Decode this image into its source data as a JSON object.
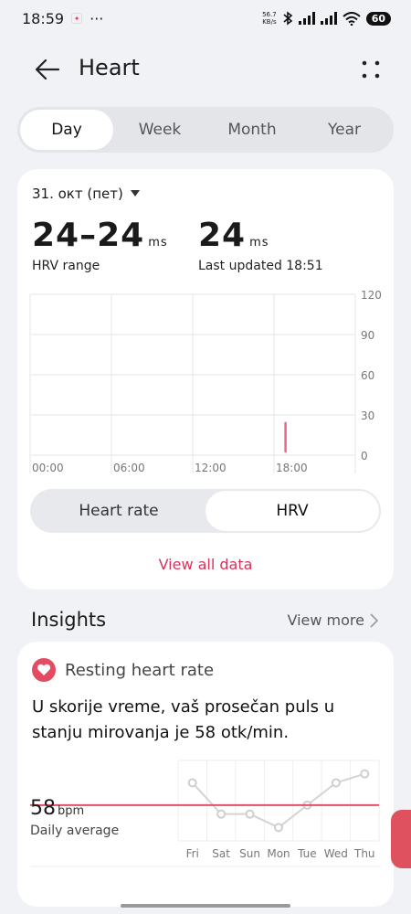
{
  "status_bar": {
    "time": "18:59",
    "dots": "···",
    "net_speed_top": "56.7",
    "net_speed_bottom": "KB/s",
    "battery": "60"
  },
  "header": {
    "title": "Heart"
  },
  "period_tabs": [
    "Day",
    "Week",
    "Month",
    "Year"
  ],
  "summary": {
    "date": "31. окт (пет)",
    "hrv_range_value": "24–24",
    "hrv_range_unit": "ms",
    "hrv_range_label": "HRV range",
    "latest_value": "24",
    "latest_unit": "ms",
    "latest_label": "Last updated 18:51"
  },
  "chart_data": [
    {
      "type": "bar",
      "x_ticks": [
        "00:00",
        "06:00",
        "12:00",
        "18:00"
      ],
      "y_ticks": [
        "120",
        "90",
        "60",
        "30",
        "0"
      ],
      "ylim": [
        0,
        120
      ],
      "series": [
        {
          "x": [
            "18:51"
          ],
          "values": [
            24
          ]
        }
      ],
      "grid": true
    },
    {
      "type": "line",
      "categories": [
        "Fri",
        "Sat",
        "Sun",
        "Mon",
        "Tue",
        "Wed",
        "Thu"
      ],
      "values": [
        63,
        56,
        56,
        53,
        58,
        63,
        65
      ],
      "reference_line": 58,
      "ylim": [
        50,
        68
      ]
    }
  ],
  "metric_toggle": {
    "options": [
      "Heart rate",
      "HRV"
    ],
    "selected": "HRV"
  },
  "view_all_label": "View all data",
  "insights": {
    "title": "Insights",
    "view_more_label": "View more",
    "card_title": "Resting heart rate",
    "text": "U skorije vreme, vaš prosečan puls u stanju mirovanja je 58 otk/min.",
    "avg_value": "58",
    "avg_unit": "bpm",
    "avg_label": "Daily average"
  },
  "colors": {
    "accent": "#d8335a",
    "background": "#f1f2f5",
    "card": "#ffffff"
  }
}
